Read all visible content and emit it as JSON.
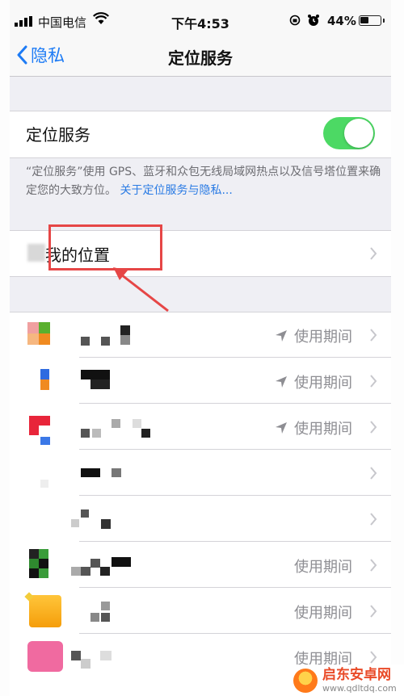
{
  "status_bar": {
    "carrier": "中国电信",
    "time": "下午4:53",
    "battery_percent": "44%",
    "battery_level": 0.44
  },
  "nav": {
    "back_label": "隐私",
    "title": "定位服务"
  },
  "location_services": {
    "label": "定位服务",
    "enabled": true,
    "toggle_color": "#4cd964",
    "description": "“定位服务”使用 GPS、蓝牙和众包无线局域网热点以及信号塔位置来确定您的大致方位。",
    "link": "关于定位服务与隐私..."
  },
  "share_location": {
    "label": "我的位置"
  },
  "apps": [
    {
      "status": "使用期间",
      "arrow": true
    },
    {
      "status": "使用期间",
      "arrow": true
    },
    {
      "status": "使用期间",
      "arrow": true
    },
    {
      "status": "",
      "arrow": false
    },
    {
      "status": "",
      "arrow": false
    },
    {
      "status": "使用期间",
      "arrow": false
    },
    {
      "status": "使用期间",
      "arrow": false
    },
    {
      "status": "使用期间",
      "arrow": false
    }
  ],
  "watermark": {
    "title": "启东安卓网",
    "url": "www.qdltdq.com"
  },
  "colors": {
    "accent": "#1d7bf5",
    "highlight": "#e64646"
  }
}
